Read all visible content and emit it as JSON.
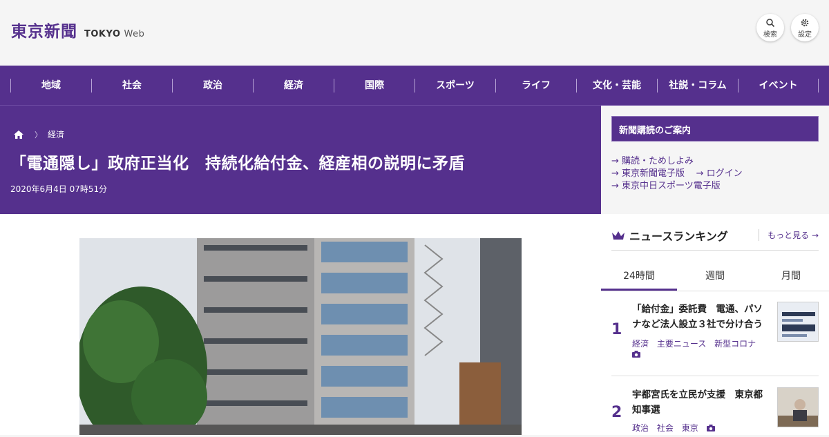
{
  "header": {
    "logo_jp": "東京新聞",
    "logo_en": "TOKYO",
    "logo_web": "Web",
    "search_label": "検索",
    "settings_label": "設定"
  },
  "nav": [
    "地域",
    "社会",
    "政治",
    "経済",
    "国際",
    "スポーツ",
    "ライフ",
    "文化・芸能",
    "社説・コラム",
    "イベント"
  ],
  "breadcrumb": {
    "section": "経済"
  },
  "article": {
    "headline": "「電通隠し」政府正当化　持続化給付金、経産相の説明に矛盾",
    "date": "2020年6月4日 07時51分"
  },
  "sidebar": {
    "subscribe_title": "新聞購読のご案内",
    "links": {
      "trial": "購読・ためしよみ",
      "digital": "東京新聞電子版",
      "login": "ログイン",
      "sports": "東京中日スポーツ電子版"
    },
    "ranking": {
      "title": "ニュースランキング",
      "more": "もっと見る",
      "tabs": [
        "24時間",
        "週間",
        "月間"
      ],
      "items": [
        {
          "rank": "1",
          "title": "「給付金」委託費　電通、パソナなど法人設立３社で分け合う",
          "tags": [
            "経済",
            "主要ニュース",
            "新型コロナ"
          ]
        },
        {
          "rank": "2",
          "title": "宇都宮氏を立民が支援　東京都知事選",
          "tags": [
            "政治",
            "社会",
            "東京"
          ]
        }
      ]
    }
  },
  "colors": {
    "brand": "#55308d",
    "background": "#f5f5f5"
  }
}
